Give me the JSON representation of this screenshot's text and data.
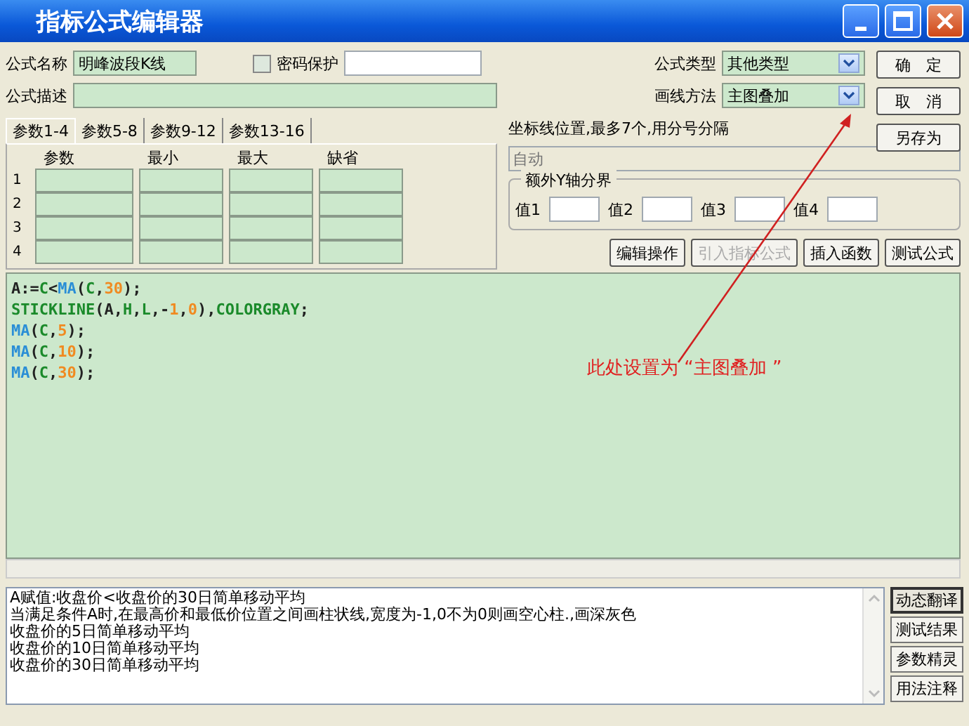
{
  "window": {
    "title": "指标公式编辑器"
  },
  "formula": {
    "name_label": "公式名称",
    "name_value": "明峰波段K线",
    "password_label": "密码保护",
    "password_checked": false,
    "desc_label": "公式描述",
    "type_label": "公式类型",
    "type_value": "其他类型",
    "draw_label": "画线方法",
    "draw_value": "主图叠加"
  },
  "tabs": [
    {
      "label": "参数1-4",
      "selected": true
    },
    {
      "label": "参数5-8",
      "selected": false
    },
    {
      "label": "参数9-12",
      "selected": false
    },
    {
      "label": "参数13-16",
      "selected": false
    }
  ],
  "param_columns": [
    "参数",
    "最小",
    "最大",
    "缺省"
  ],
  "param_rows": [
    "1",
    "2",
    "3",
    "4"
  ],
  "axis": {
    "label": "坐标线位置,最多7个,用分号分隔",
    "placeholder": "自动"
  },
  "y_split": {
    "title": "额外Y轴分界",
    "fields": [
      "值1",
      "值2",
      "值3",
      "值4"
    ]
  },
  "side_buttons": [
    {
      "label": "确　定",
      "disabled": false
    },
    {
      "label": "取　消",
      "disabled": false
    },
    {
      "label": "另存为",
      "disabled": false
    }
  ],
  "tool_buttons": [
    {
      "label": "编辑操作",
      "disabled": false
    },
    {
      "label": "引入指标公式",
      "disabled": true
    },
    {
      "label": "插入函数",
      "disabled": false
    },
    {
      "label": "测试公式",
      "disabled": false
    }
  ],
  "code_lines": [
    [
      {
        "text": "A:=",
        "kind": "plain"
      },
      {
        "text": "C",
        "kind": "const"
      },
      {
        "text": "<",
        "kind": "plain"
      },
      {
        "text": "MA",
        "kind": "func"
      },
      {
        "text": "(",
        "kind": "plain"
      },
      {
        "text": "C",
        "kind": "const"
      },
      {
        "text": ",",
        "kind": "plain"
      },
      {
        "text": "30",
        "kind": "num"
      },
      {
        "text": ");",
        "kind": "plain"
      }
    ],
    [
      {
        "text": "STICKLINE",
        "kind": "const"
      },
      {
        "text": "(A,",
        "kind": "plain"
      },
      {
        "text": "H",
        "kind": "const"
      },
      {
        "text": ",",
        "kind": "plain"
      },
      {
        "text": "L",
        "kind": "const"
      },
      {
        "text": ",-",
        "kind": "plain"
      },
      {
        "text": "1",
        "kind": "num"
      },
      {
        "text": ",",
        "kind": "plain"
      },
      {
        "text": "0",
        "kind": "num"
      },
      {
        "text": "),",
        "kind": "plain"
      },
      {
        "text": "COLORGRAY",
        "kind": "const"
      },
      {
        "text": ";",
        "kind": "plain"
      }
    ],
    [
      {
        "text": "MA",
        "kind": "func"
      },
      {
        "text": "(",
        "kind": "plain"
      },
      {
        "text": "C",
        "kind": "const"
      },
      {
        "text": ",",
        "kind": "plain"
      },
      {
        "text": "5",
        "kind": "num"
      },
      {
        "text": ");",
        "kind": "plain"
      }
    ],
    [
      {
        "text": "MA",
        "kind": "func"
      },
      {
        "text": "(",
        "kind": "plain"
      },
      {
        "text": "C",
        "kind": "const"
      },
      {
        "text": ",",
        "kind": "plain"
      },
      {
        "text": "10",
        "kind": "num"
      },
      {
        "text": ");",
        "kind": "plain"
      }
    ],
    [
      {
        "text": "MA",
        "kind": "func"
      },
      {
        "text": "(",
        "kind": "plain"
      },
      {
        "text": "C",
        "kind": "const"
      },
      {
        "text": ",",
        "kind": "plain"
      },
      {
        "text": "30",
        "kind": "num"
      },
      {
        "text": ");",
        "kind": "plain"
      }
    ]
  ],
  "annotation": "此处设置为 “主图叠加 ”",
  "explanation": [
    "A赋值:收盘价<收盘价的30日简单移动平均",
    "当满足条件A时,在最高价和最低价位置之间画柱状线,宽度为-1,0不为0则画空心柱.,画深灰色",
    "收盘价的5日简单移动平均",
    "收盘价的10日简单移动平均",
    "收盘价的30日简单移动平均"
  ],
  "bottom_buttons": [
    {
      "label": "动态翻译",
      "selected": true
    },
    {
      "label": "测试结果",
      "selected": false
    },
    {
      "label": "参数精灵",
      "selected": false
    },
    {
      "label": "用法注释",
      "selected": false
    }
  ]
}
